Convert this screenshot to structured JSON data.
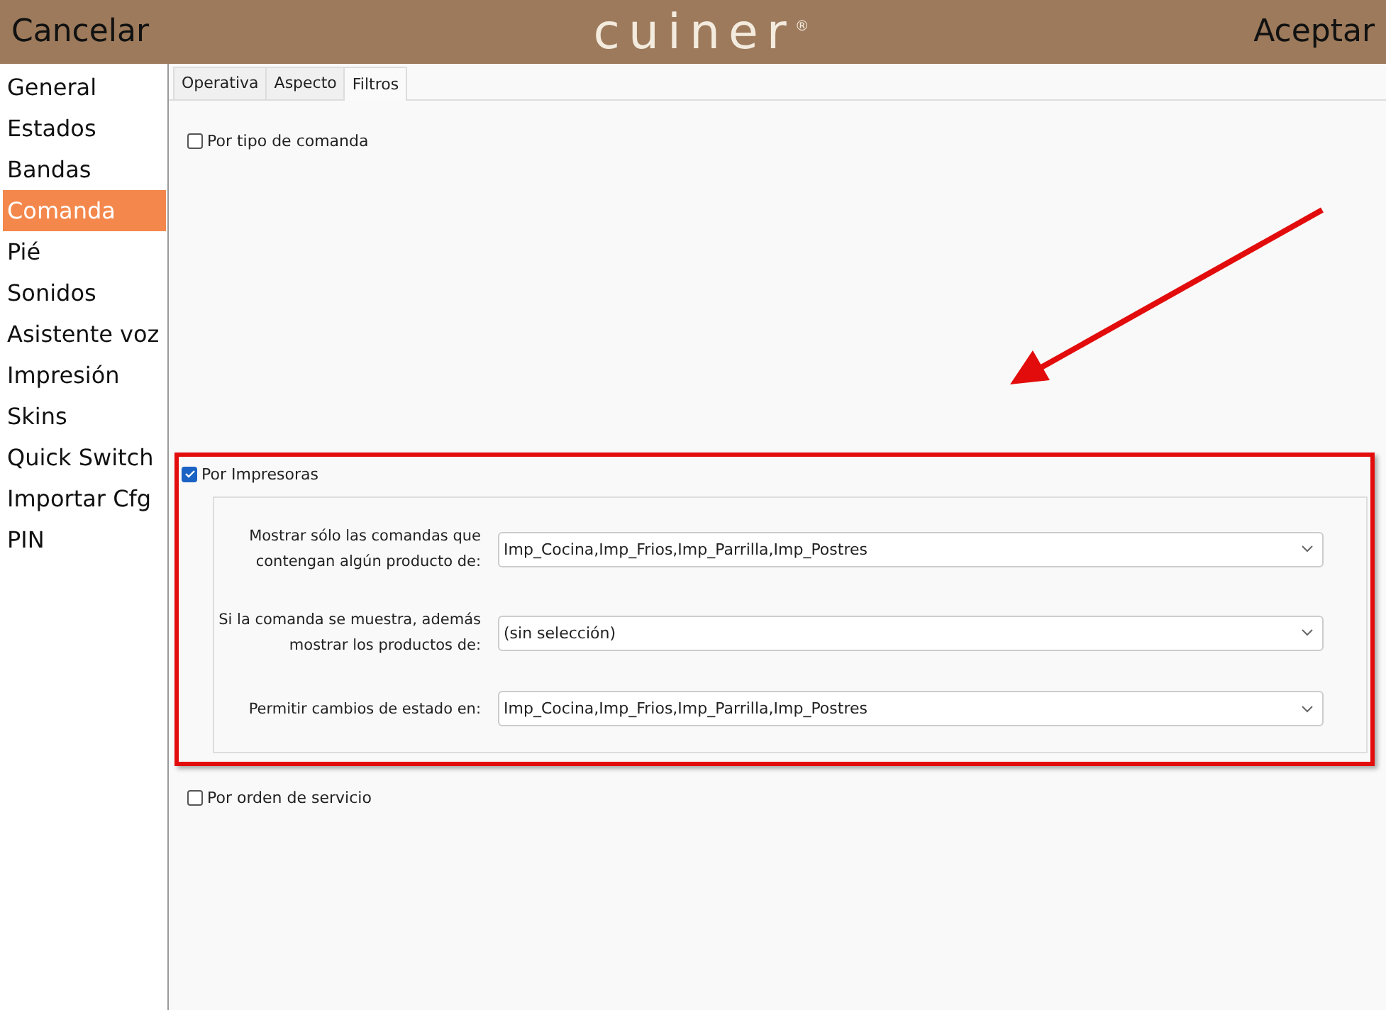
{
  "header": {
    "cancel": "Cancelar",
    "logo": "cuiner$^{®}$",
    "accept": "Aceptar"
  },
  "sidebar": {
    "items": [
      {
        "label": "General",
        "selected": false
      },
      {
        "label": "Estados",
        "selected": false
      },
      {
        "label": "Bandas",
        "selected": false
      },
      {
        "label": "Comanda",
        "selected": true
      },
      {
        "label": "Pié",
        "selected": false
      },
      {
        "label": "Sonidos",
        "selected": false
      },
      {
        "label": "Asistente voz",
        "selected": false
      },
      {
        "label": "Impresión",
        "selected": false
      },
      {
        "label": "Skins",
        "selected": false
      },
      {
        "label": "Quick Switch",
        "selected": false
      },
      {
        "label": "Importar Cfg",
        "selected": false
      },
      {
        "label": "PIN",
        "selected": false
      }
    ]
  },
  "tabs": [
    {
      "label": "Operativa",
      "selected": false
    },
    {
      "label": "Aspecto",
      "selected": false
    },
    {
      "label": "Filtros",
      "selected": true
    }
  ],
  "filters": [
    {
      "label": "Por tipo de comanda",
      "checked": false
    },
    {
      "label": "Por Impresoras",
      "checked": true,
      "highlighted": true,
      "fields": [
        {
          "label": "Mostrar sólo las comandas que contengan algún producto de:",
          "value": "Imp_Cocina,Imp_Frios,Imp_Parrilla,Imp_Postres"
        },
        {
          "label": "Si la comanda se muestra, además mostrar los productos de:",
          "value": "(sin selección)"
        },
        {
          "label": "Permitir cambios de estado en:",
          "value": "Imp_Cocina,Imp_Frios,Imp_Parrilla,Imp_Postres"
        }
      ]
    },
    {
      "label": "Por orden de servicio",
      "checked": false
    }
  ]
}
